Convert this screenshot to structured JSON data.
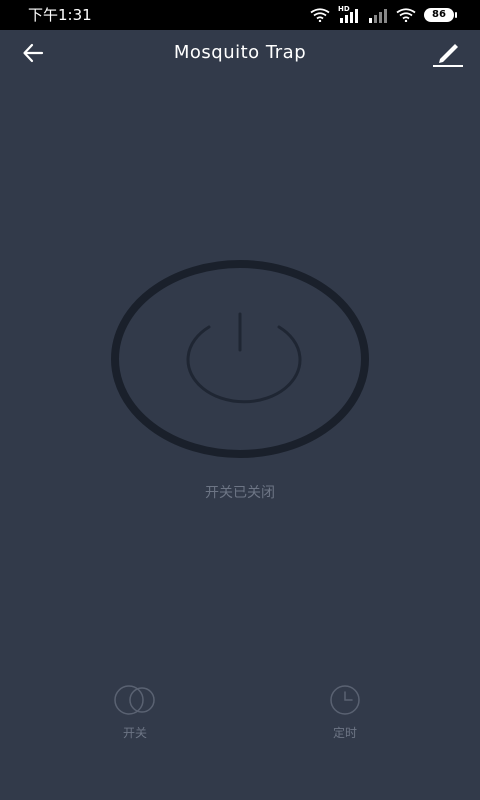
{
  "status_bar": {
    "time": "下午1:31",
    "hd_label": "HD",
    "battery": "86"
  },
  "header": {
    "title": "Mosquito Trap",
    "back_icon": "arrow-left-icon",
    "edit_icon": "pencil-icon"
  },
  "power": {
    "icon": "power-icon",
    "status_text": "开关已关闭"
  },
  "bottom_actions": {
    "switch_label": "开关",
    "switch_icon": "toggle-circles-icon",
    "timer_label": "定时",
    "timer_icon": "clock-icon"
  },
  "colors": {
    "background": "#323a4a",
    "status_bar": "#000000",
    "ring": "#1a202b",
    "muted_text": "#6d7585"
  }
}
